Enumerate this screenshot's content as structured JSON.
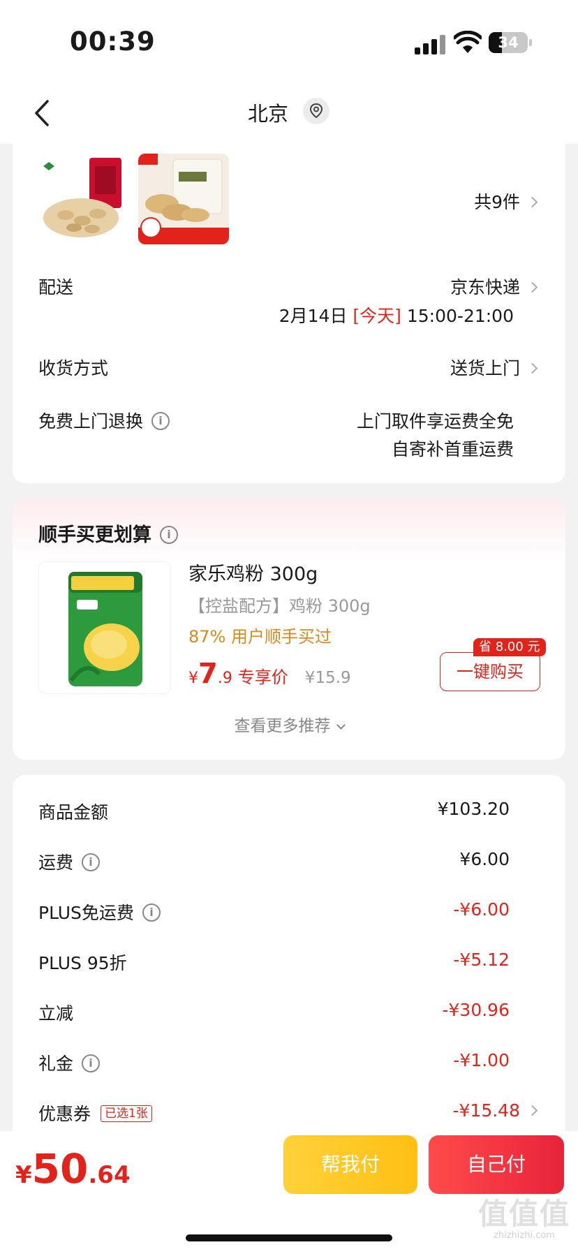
{
  "status": {
    "time": "00:39",
    "battery": "34",
    "battery_level": 0.34
  },
  "nav": {
    "title": "北京"
  },
  "items": {
    "count_label": "共9件"
  },
  "delivery": {
    "label": "配送",
    "carrier": "京东快递",
    "date": "2月14日",
    "today": "[今天]",
    "slot": "15:00-21:00"
  },
  "receive": {
    "label": "收货方式",
    "value": "送货上门"
  },
  "returns": {
    "label": "免费上门退换",
    "line1": "上门取件享运费全免",
    "line2": "自寄补首重运费"
  },
  "addon": {
    "title": "顺手买更划算",
    "product_name": "家乐鸡粉 300g",
    "product_sub": "【控盐配方】鸡粉 300g",
    "promo": "87% 用户顺手买过",
    "price_symbol": "¥",
    "price_int": "7",
    "price_dec": ".9",
    "price_tag": "专享价",
    "orig_price": "¥15.9",
    "save_badge": "省 8.00 元",
    "buy_label": "一键购买",
    "more_label": "查看更多推荐"
  },
  "summary": [
    {
      "label": "商品金额",
      "value": "¥103.20",
      "red": false,
      "info": false
    },
    {
      "label": "运费",
      "value": "¥6.00",
      "red": false,
      "info": true
    },
    {
      "label": "PLUS免运费",
      "value": "-¥6.00",
      "red": true,
      "info": true
    },
    {
      "label": "PLUS 95折",
      "value": "-¥5.12",
      "red": true,
      "info": false
    },
    {
      "label": "立减",
      "value": "-¥30.96",
      "red": true,
      "info": false
    },
    {
      "label": "礼金",
      "value": "-¥1.00",
      "red": true,
      "info": true
    },
    {
      "label": "优惠券",
      "value": "-¥15.48",
      "red": true,
      "info": false
    }
  ],
  "coupon_tag": "已选1张",
  "bottom": {
    "symbol": "¥",
    "total_int": "50",
    "total_dec": ".64",
    "help_pay": "帮我付",
    "self_pay": "自己付"
  },
  "watermark": {
    "glyph": "值值值",
    "text": "zhizhizhi.com"
  },
  "colors": {
    "accent_red": "#e2231a",
    "yellow": "#ffc61f",
    "promo_orange": "#d68a1e"
  }
}
